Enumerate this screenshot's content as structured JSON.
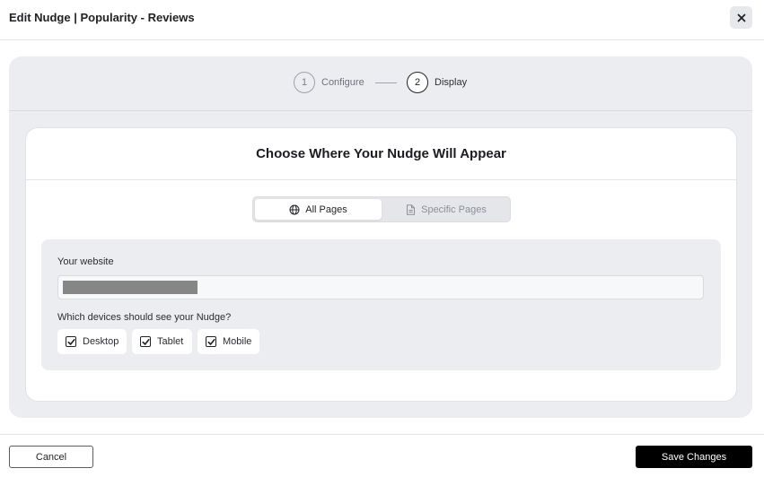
{
  "header": {
    "title": "Edit Nudge | Popularity - Reviews",
    "close_icon": "close-icon"
  },
  "stepper": {
    "steps": [
      {
        "number": "1",
        "label": "Configure",
        "state": "inactive"
      },
      {
        "number": "2",
        "label": "Display",
        "state": "active"
      }
    ]
  },
  "card": {
    "title": "Choose Where Your Nudge Will Appear"
  },
  "page_scope": {
    "options": [
      {
        "label": "All Pages",
        "icon": "globe-icon",
        "selected": true
      },
      {
        "label": "Specific Pages",
        "icon": "document-icon",
        "selected": false
      }
    ]
  },
  "settings": {
    "website_label": "Your website",
    "website_value": "",
    "devices_label": "Which devices should see your Nudge?",
    "devices": [
      {
        "label": "Desktop",
        "checked": true
      },
      {
        "label": "Tablet",
        "checked": true
      },
      {
        "label": "Mobile",
        "checked": true
      }
    ]
  },
  "footer": {
    "cancel_label": "Cancel",
    "save_label": "Save Changes"
  },
  "colors": {
    "primary_button": "#000000",
    "panel_background": "#ebedf0",
    "card_background": "#ffffff"
  }
}
